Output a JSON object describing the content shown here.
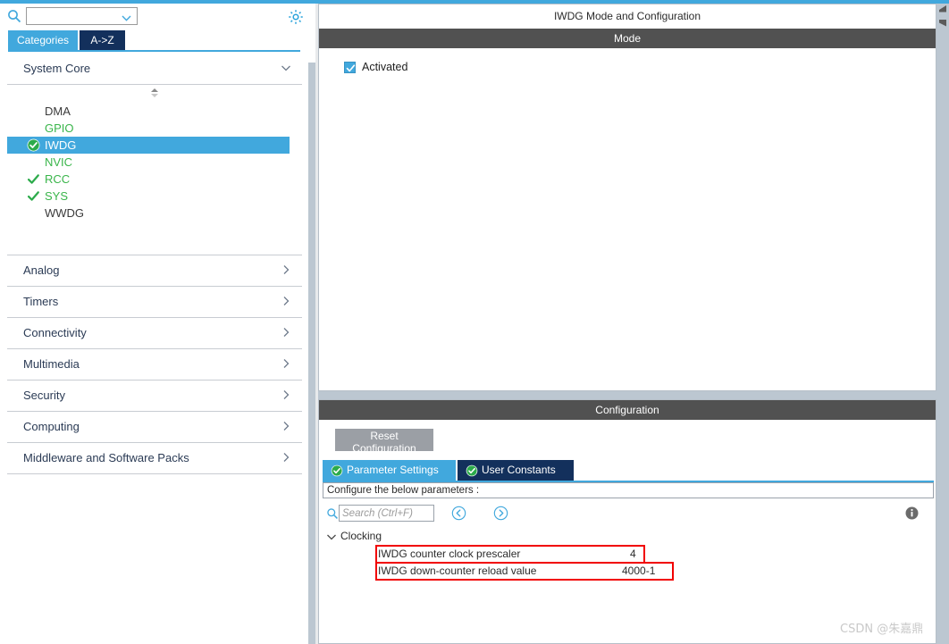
{
  "left_panel": {
    "search": {
      "value": "",
      "placeholder": ""
    },
    "gear_icon": "gear-icon",
    "tabs": [
      {
        "id": "categories",
        "label": "Categories",
        "active": true
      },
      {
        "id": "a-z",
        "label": "A->Z",
        "active": false
      }
    ],
    "categories": [
      {
        "id": "system-core",
        "label": "System Core",
        "expanded": true
      },
      {
        "id": "analog",
        "label": "Analog",
        "expanded": false
      },
      {
        "id": "timers",
        "label": "Timers",
        "expanded": false
      },
      {
        "id": "connectivity",
        "label": "Connectivity",
        "expanded": false
      },
      {
        "id": "multimedia",
        "label": "Multimedia",
        "expanded": false
      },
      {
        "id": "security",
        "label": "Security",
        "expanded": false
      },
      {
        "id": "computing",
        "label": "Computing",
        "expanded": false
      },
      {
        "id": "middleware",
        "label": "Middleware and Software Packs",
        "expanded": false
      }
    ],
    "peripherals": [
      {
        "label": "DMA",
        "state": "none",
        "selected": false
      },
      {
        "label": "GPIO",
        "state": "green-text",
        "selected": false
      },
      {
        "label": "IWDG",
        "state": "checked",
        "selected": true
      },
      {
        "label": "NVIC",
        "state": "green-text",
        "selected": false
      },
      {
        "label": "RCC",
        "state": "check",
        "selected": false
      },
      {
        "label": "SYS",
        "state": "check",
        "selected": false
      },
      {
        "label": "WWDG",
        "state": "none",
        "selected": false
      }
    ]
  },
  "right_panel": {
    "title": "IWDG Mode and Configuration",
    "mode_section": {
      "header": "Mode",
      "checkbox": {
        "label": "Activated",
        "checked": true
      }
    },
    "configuration_section": {
      "header": "Configuration",
      "reset_button": "Reset Configuration",
      "tabs": [
        {
          "id": "parameter-settings",
          "label": "Parameter Settings",
          "active": true
        },
        {
          "id": "user-constants",
          "label": "User Constants",
          "active": false
        }
      ],
      "banner": "Configure the below parameters :",
      "search": {
        "value": "",
        "placeholder": "Search (Ctrl+F)"
      },
      "nav_prev_icon": "arrow-left-circle-icon",
      "nav_next_icon": "arrow-right-circle-icon",
      "info_icon": "info-icon",
      "groups": [
        {
          "name": "Clocking",
          "expanded": true,
          "parameters": [
            {
              "name": "IWDG counter clock prescaler",
              "value": "4",
              "highlighted": true
            },
            {
              "name": "IWDG down-counter reload value",
              "value": "4000-1",
              "highlighted": true
            }
          ]
        }
      ]
    }
  },
  "watermark": "CSDN @朱嘉鼎",
  "colors": {
    "accent_blue": "#41a8dd",
    "dark_navy": "#13305c",
    "section_gray": "#515151",
    "green": "#39b54a",
    "highlight_red": "#f10000",
    "scrollbar": "#bcc7d1"
  }
}
